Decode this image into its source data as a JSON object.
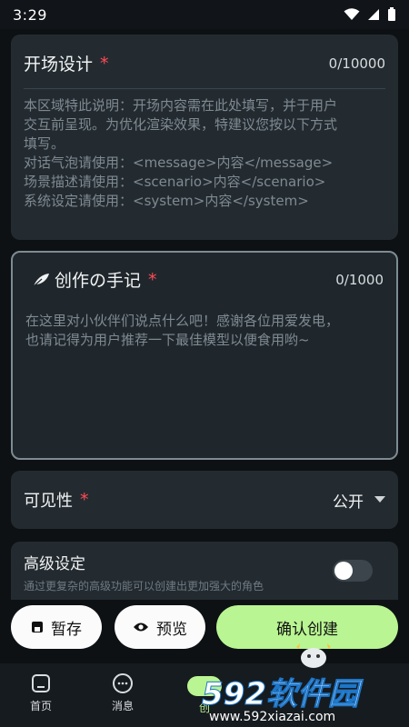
{
  "status_bar": {
    "time": "3:29"
  },
  "opening": {
    "title": "开场设计",
    "required_mark": "*",
    "count": "0/10000",
    "description": "本区域特此说明：开场内容需在此处填写，并于用户\n交互前呈现。为优化渲染效果，特建议您按以下方式\n填写。\n对话气泡请使用：<message>内容</message>\n场景描述请使用：<scenario>内容</scenario>\n系统设定请使用：<system>内容</system>"
  },
  "note": {
    "icon": "feather-icon",
    "title": "创作の手记",
    "required_mark": "*",
    "count": "0/1000",
    "placeholder": "在这里对小伙伴们说点什么吧！感谢各位用爱发电，\n也请记得为用户推荐一下最佳模型以便食用哟~"
  },
  "visibility": {
    "label": "可见性",
    "required_mark": "*",
    "value": "公开"
  },
  "advanced": {
    "title": "高级设定",
    "subtitle": "通过更复杂的高级功能可以创建出更加强大的角色",
    "enabled": false
  },
  "actions": {
    "save": "暂存",
    "preview": "预览",
    "confirm": "确认创建"
  },
  "nav": [
    {
      "label": "首页",
      "icon": "home-icon"
    },
    {
      "label": "消息",
      "icon": "chat-icon"
    },
    {
      "label": "创",
      "icon": "create-icon"
    }
  ],
  "watermark": {
    "logo": "592软件园",
    "url": "www.592xiazai.com"
  },
  "colors": {
    "accent": "#b9f592",
    "required": "#ff4b55",
    "card": "#232b31",
    "background": "#0d1114"
  }
}
